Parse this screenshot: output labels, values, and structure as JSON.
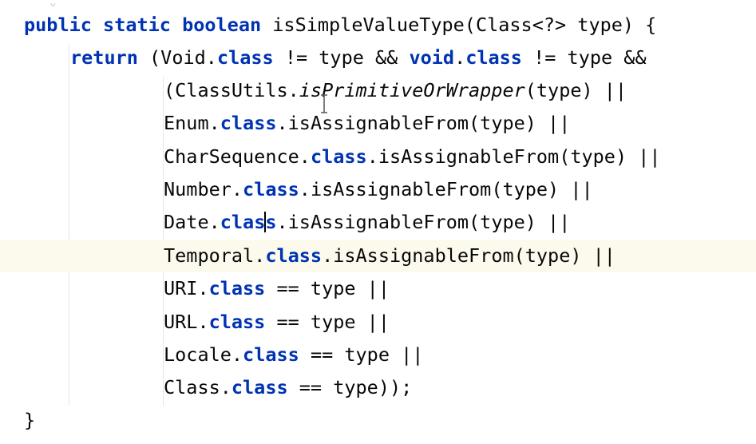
{
  "editor": {
    "language": "java",
    "colors": {
      "background": "#ffffff",
      "keyword": "#0033b3",
      "text": "#080808",
      "current_line": "#fcfaed",
      "indent_guide": "#e6e6e6"
    },
    "current_line_index": 7,
    "lines": [
      {
        "tokens": [
          {
            "t": "public",
            "s": "kw"
          },
          {
            "t": " "
          },
          {
            "t": "static",
            "s": "kw"
          },
          {
            "t": " "
          },
          {
            "t": "boolean",
            "s": "kw"
          },
          {
            "t": " isSimpleValueType(Class<?> type) {"
          }
        ]
      },
      {
        "tokens": [
          {
            "t": "return",
            "s": "kw"
          },
          {
            "t": " (Void."
          },
          {
            "t": "class",
            "s": "kw"
          },
          {
            "t": " != type && "
          },
          {
            "t": "void",
            "s": "kw"
          },
          {
            "t": "."
          },
          {
            "t": "class",
            "s": "kw"
          },
          {
            "t": " != type &&"
          }
        ]
      },
      {
        "tokens": [
          {
            "t": "(ClassUtils."
          },
          {
            "t": "isPrimitiveOrWrapper",
            "s": "it"
          },
          {
            "t": "(type) ||"
          }
        ]
      },
      {
        "tokens": [
          {
            "t": "Enum."
          },
          {
            "t": "class",
            "s": "kw"
          },
          {
            "t": ".isAssignableFrom(type) ||"
          }
        ]
      },
      {
        "tokens": [
          {
            "t": "CharSequence."
          },
          {
            "t": "class",
            "s": "kw"
          },
          {
            "t": ".isAssignableFrom(type) ||"
          }
        ]
      },
      {
        "tokens": [
          {
            "t": "Number."
          },
          {
            "t": "class",
            "s": "kw"
          },
          {
            "t": ".isAssignableFrom(type) ||"
          }
        ]
      },
      {
        "tokens": [
          {
            "t": "Date."
          },
          {
            "t": "clas",
            "s": "kw"
          },
          {
            "t": "",
            "s": "caret"
          },
          {
            "t": "s",
            "s": "kw"
          },
          {
            "t": ".isAssignableFrom(type) ||"
          }
        ]
      },
      {
        "tokens": [
          {
            "t": "Temporal."
          },
          {
            "t": "class",
            "s": "kw"
          },
          {
            "t": ".isAssignableFrom(type) ||"
          }
        ]
      },
      {
        "tokens": [
          {
            "t": "URI."
          },
          {
            "t": "class",
            "s": "kw"
          },
          {
            "t": " == type ||"
          }
        ]
      },
      {
        "tokens": [
          {
            "t": "URL."
          },
          {
            "t": "class",
            "s": "kw"
          },
          {
            "t": " == type ||"
          }
        ]
      },
      {
        "tokens": [
          {
            "t": "Locale."
          },
          {
            "t": "class",
            "s": "kw"
          },
          {
            "t": " == type ||"
          }
        ]
      },
      {
        "tokens": [
          {
            "t": "Class."
          },
          {
            "t": "class",
            "s": "kw"
          },
          {
            "t": " == type));"
          }
        ]
      },
      {
        "tokens": [
          {
            "t": "}"
          }
        ]
      }
    ]
  }
}
